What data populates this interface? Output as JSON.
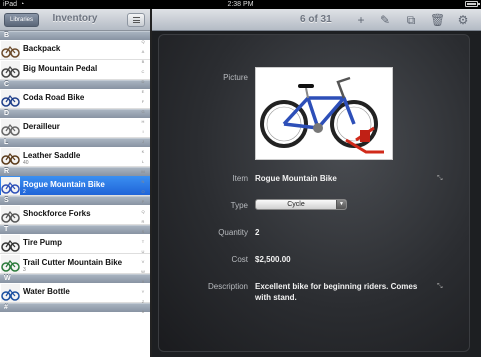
{
  "status_bar": {
    "carrier": "iPad",
    "time": "2:38 PM",
    "battery_level": 0.85
  },
  "left_pane": {
    "libraries_label": "Libraries",
    "title": "Inventory",
    "sections": [
      {
        "letter": "B",
        "items": [
          {
            "name": "Backpack",
            "sub": ""
          },
          {
            "name": "Big Mountain Pedal",
            "sub": ""
          }
        ]
      },
      {
        "letter": "C",
        "items": [
          {
            "name": "Coda Road Bike",
            "sub": ""
          }
        ]
      },
      {
        "letter": "D",
        "items": [
          {
            "name": "Derailleur",
            "sub": ""
          }
        ]
      },
      {
        "letter": "L",
        "items": [
          {
            "name": "Leather Saddle",
            "sub": "40"
          }
        ]
      },
      {
        "letter": "R",
        "items": [
          {
            "name": "Rogue Mountain Bike",
            "sub": "2",
            "selected": true
          }
        ]
      },
      {
        "letter": "S",
        "items": [
          {
            "name": "Shockforce Forks",
            "sub": ""
          }
        ]
      },
      {
        "letter": "T",
        "items": [
          {
            "name": "Tire Pump",
            "sub": ""
          },
          {
            "name": "Trail Cutter Mountain Bike",
            "sub": "3"
          }
        ]
      },
      {
        "letter": "W",
        "items": [
          {
            "name": "Water Bottle",
            "sub": ""
          }
        ]
      },
      {
        "letter": "#",
        "items": []
      }
    ],
    "index_letters": [
      "Q",
      "A",
      "B",
      "C",
      "D",
      "E",
      "F",
      "G",
      "H",
      "I",
      "J",
      "K",
      "L",
      "M",
      "N",
      "O",
      "P",
      "Q",
      "R",
      "S",
      "T",
      "U",
      "V",
      "W",
      "X",
      "Y",
      "Z",
      "#"
    ]
  },
  "right_pane": {
    "counter": "6 of 31",
    "toolbar_icons": [
      "add-icon",
      "edit-pencil-icon",
      "copy-icon",
      "trash-icon",
      "gear-icon"
    ],
    "fields": {
      "picture_label": "Picture",
      "item_label": "Item",
      "item_value": "Rogue Mountain Bike",
      "type_label": "Type",
      "type_value": "Cycle",
      "quantity_label": "Quantity",
      "quantity_value": "2",
      "cost_label": "Cost",
      "cost_value": "$2,500.00",
      "description_label": "Description",
      "description_value": "Excellent bike for beginning riders. Comes with stand."
    }
  }
}
